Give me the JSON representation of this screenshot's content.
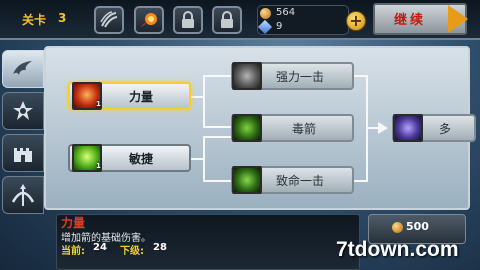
{
  "header": {
    "level_label": "关卡",
    "level_number": "3",
    "slots": [
      {
        "name": "claw-slash-icon",
        "locked": false
      },
      {
        "name": "fireball-icon",
        "locked": false
      },
      {
        "name": "lock-icon",
        "locked": true
      },
      {
        "name": "lock-icon",
        "locked": true
      }
    ],
    "coins": "564",
    "gems": "9",
    "continue_label": "继续"
  },
  "tabs": [
    {
      "name": "wing-tab",
      "active": true
    },
    {
      "name": "star-tab",
      "active": false
    },
    {
      "name": "castle-tab",
      "active": false
    },
    {
      "name": "bow-tab",
      "active": false
    }
  ],
  "skill_tree": {
    "nodes": [
      {
        "id": "strength",
        "label": "力量",
        "level": "1",
        "selected": true,
        "icon": "strength-fist-icon"
      },
      {
        "id": "agility",
        "label": "敏捷",
        "level": "1",
        "selected": false,
        "icon": "agility-icon"
      },
      {
        "id": "power_shot",
        "label": "强力一击",
        "locked": true,
        "icon": "power-shot-icon"
      },
      {
        "id": "poison_arrow",
        "label": "毒箭",
        "locked": true,
        "icon": "poison-arrow-icon"
      },
      {
        "id": "fatal_strike",
        "label": "致命一击",
        "locked": true,
        "icon": "fatal-strike-icon"
      },
      {
        "id": "multi_shot",
        "label": "多",
        "locked": true,
        "icon": "multi-shot-icon"
      }
    ]
  },
  "info": {
    "title": "力量",
    "description": "增加箭的基础伤害。",
    "current_label": "当前:",
    "current_value": "24",
    "next_label": "下级:",
    "next_value": "28"
  },
  "upgrade": {
    "cost": "500"
  },
  "watermark": "7tdown.com",
  "colors": {
    "accent_gold": "#f3d031",
    "title_red": "#e03b26",
    "continue_red": "#c31a0a"
  }
}
